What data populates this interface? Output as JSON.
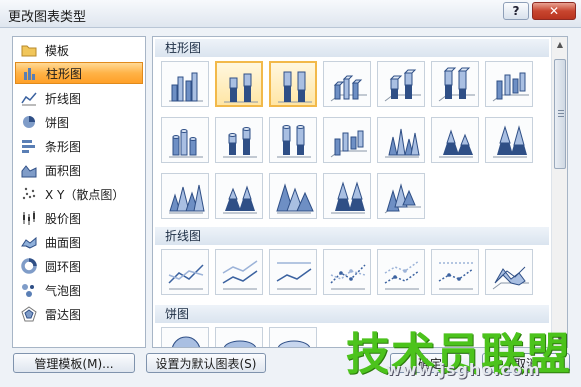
{
  "window": {
    "title": "更改图表类型",
    "help": "?",
    "close": "✕"
  },
  "sidebar": {
    "items": [
      {
        "label": "模板",
        "icon": "folder-icon",
        "selected": false
      },
      {
        "label": "柱形图",
        "icon": "column-chart-icon",
        "selected": true
      },
      {
        "label": "折线图",
        "icon": "line-chart-icon",
        "selected": false
      },
      {
        "label": "饼图",
        "icon": "pie-chart-icon",
        "selected": false
      },
      {
        "label": "条形图",
        "icon": "bar-chart-icon",
        "selected": false
      },
      {
        "label": "面积图",
        "icon": "area-chart-icon",
        "selected": false
      },
      {
        "label": "X Y（散点图）",
        "icon": "scatter-chart-icon",
        "selected": false
      },
      {
        "label": "股价图",
        "icon": "stock-chart-icon",
        "selected": false
      },
      {
        "label": "曲面图",
        "icon": "surface-chart-icon",
        "selected": false
      },
      {
        "label": "圆环图",
        "icon": "doughnut-chart-icon",
        "selected": false
      },
      {
        "label": "气泡图",
        "icon": "bubble-chart-icon",
        "selected": false
      },
      {
        "label": "雷达图",
        "icon": "radar-chart-icon",
        "selected": false
      }
    ]
  },
  "gallery": {
    "sections": [
      {
        "title": "柱形图"
      },
      {
        "title": "折线图"
      },
      {
        "title": "饼图"
      }
    ],
    "selected_index": 1
  },
  "buttons": {
    "manage": "管理模板(M)...",
    "set_default": "设置为默认图表(S)",
    "ok": "确定",
    "cancel": "取消"
  },
  "watermark": {
    "line1": "技术员联盟",
    "line2": "www.jsgho.com"
  },
  "colors": {
    "selection": "#ffb347",
    "accent_blue": "#4f6fa8"
  }
}
